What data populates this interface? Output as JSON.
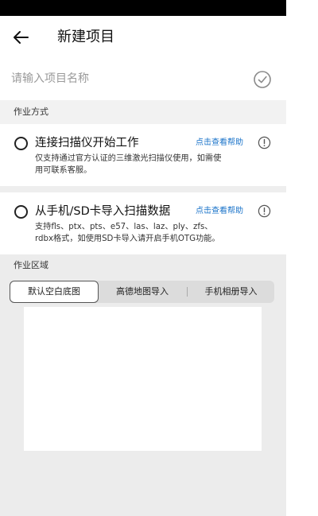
{
  "header": {
    "title": "新建项目",
    "back_icon": "arrow-left-icon"
  },
  "project_name": {
    "placeholder": "请输入项目名称",
    "value": "",
    "confirm_icon": "check-circle-icon"
  },
  "work_mode": {
    "section_title": "作业方式",
    "options": [
      {
        "title": "连接扫描仪开始工作",
        "help_label": "点击查看帮助",
        "desc_line1": "仅支持通过官方认证的三维激光扫描仪使用，如需使",
        "desc_line2": "用可联系客服。",
        "selected": false
      },
      {
        "title": "从手机/SD卡导入扫描数据",
        "help_label": "点击查看帮助",
        "desc_line1": "支持fls、ptx、pts、e57、las、laz、ply、zfs、",
        "desc_line2": "rdbx格式，如使用SD卡导入请开启手机OTG功能。",
        "selected": false
      }
    ]
  },
  "work_area": {
    "section_title": "作业区域",
    "tabs": [
      {
        "label": "默认空白底图",
        "active": true
      },
      {
        "label": "高德地图导入",
        "active": false
      },
      {
        "label": "手机相册导入",
        "active": false
      }
    ]
  },
  "colors": {
    "link": "#1a73c9",
    "section_bg": "#f2f2f2",
    "status_bar": "#000000"
  }
}
